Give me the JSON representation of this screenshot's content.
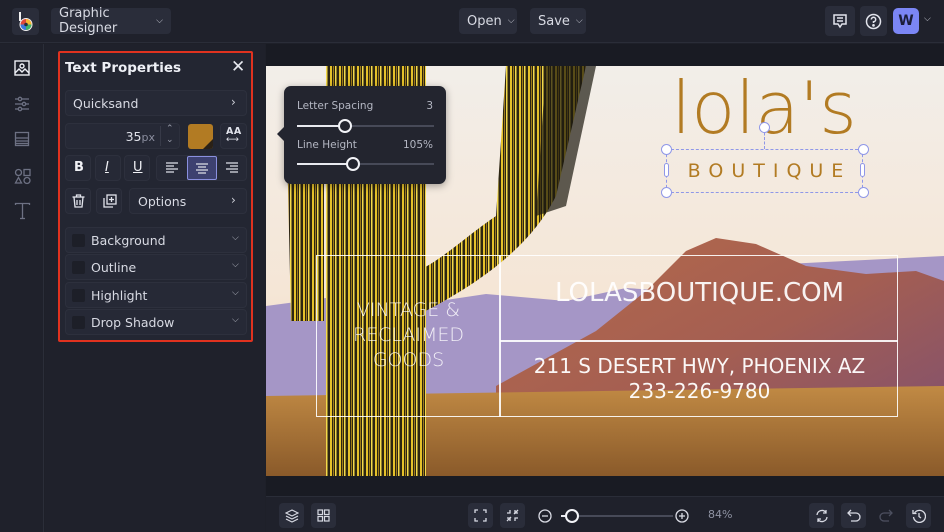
{
  "topbar": {
    "app_mode": "Graphic Designer",
    "open_label": "Open",
    "save_label": "Save",
    "avatar_initial": "W",
    "icons": [
      "logo-icon",
      "comments-icon",
      "help-icon"
    ]
  },
  "rail": {
    "items": [
      {
        "name": "image-manager",
        "icon": "image-icon",
        "active": true
      },
      {
        "name": "adjustments",
        "icon": "sliders-icon",
        "active": false
      },
      {
        "name": "backgrounds",
        "icon": "layout-icon",
        "active": false
      },
      {
        "name": "graphics",
        "icon": "shapes-icon",
        "active": false
      },
      {
        "name": "text",
        "icon": "text-icon",
        "active": false
      }
    ]
  },
  "panel": {
    "title": "Text Properties",
    "font": "Quicksand",
    "font_size": "35",
    "font_size_unit": "px",
    "text_color": "#b27b23",
    "style_buttons": {
      "bold": "B",
      "italic": "I",
      "underline": "U"
    },
    "alignment_selected": "center",
    "options_label": "Options",
    "effects": [
      {
        "label": "Background",
        "checked": false
      },
      {
        "label": "Outline",
        "checked": false
      },
      {
        "label": "Highlight",
        "checked": false
      },
      {
        "label": "Drop Shadow",
        "checked": false
      }
    ]
  },
  "popover": {
    "letter_spacing_label": "Letter Spacing",
    "letter_spacing_value": "3",
    "letter_spacing_fraction": 0.35,
    "line_height_label": "Line Height",
    "line_height_value": "105%",
    "line_height_fraction": 0.41
  },
  "canvas": {
    "logo_text": "lola's",
    "subtitle_text": "BOUTIQUE",
    "tagline_lines": [
      "VINTAGE &",
      "RECLAIMED",
      "GOODS"
    ],
    "website": "LOLASBOUTIQUE.COM",
    "address": "211 S DESERT HWY, PHOENIX AZ",
    "phone": "233-226-9780",
    "brand_color": "#b27b23",
    "selection_color": "#8f97e8"
  },
  "bottombar": {
    "zoom_percent": "84%",
    "zoom_fraction": 0.1
  }
}
